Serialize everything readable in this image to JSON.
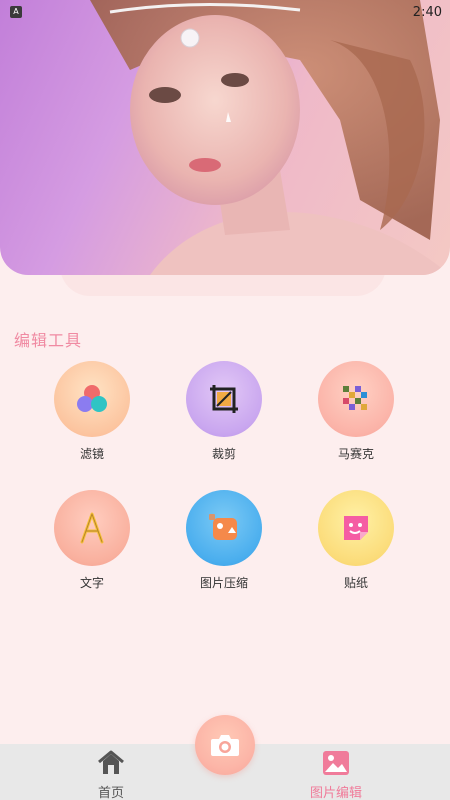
{
  "status_bar": {
    "badge": "A",
    "time": "2:40"
  },
  "section": {
    "title": "编辑工具"
  },
  "tools": [
    {
      "label": "滤镜",
      "icon": "filter-icon"
    },
    {
      "label": "裁剪",
      "icon": "crop-icon"
    },
    {
      "label": "马赛克",
      "icon": "mosaic-icon"
    },
    {
      "label": "文字",
      "icon": "text-icon"
    },
    {
      "label": "图片压缩",
      "icon": "compress-icon"
    },
    {
      "label": "贴纸",
      "icon": "sticker-icon"
    }
  ],
  "nav": {
    "home_label": "首页",
    "edit_label": "图片编辑",
    "active_color": "#f07b9a",
    "inactive_color": "#555555"
  },
  "colors": {
    "accent": "#f08aa2",
    "background": "#fdeeee"
  }
}
